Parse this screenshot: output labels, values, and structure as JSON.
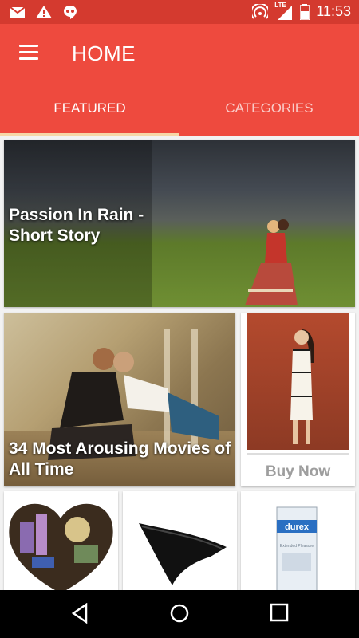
{
  "status_bar": {
    "icons": [
      "gmail-icon",
      "warning-icon",
      "hangouts-icon",
      "hotspot-icon",
      "lte-signal-icon",
      "battery-icon"
    ],
    "network": "LTE",
    "time": "11:53"
  },
  "app_bar": {
    "title": "HOME",
    "menu_icon": "menu-icon"
  },
  "tabs": [
    {
      "label": "FEATURED",
      "active": true
    },
    {
      "label": "CATEGORIES",
      "active": false
    }
  ],
  "featured": {
    "cards": [
      {
        "title": "Passion In Rain - Short Story"
      },
      {
        "title": "34 Most Arousing Movies of All Time"
      }
    ],
    "shop": {
      "button_label": "Buy Now"
    },
    "products": [
      {
        "name": "heart-gift-basket"
      },
      {
        "name": "black-lace-lingerie"
      },
      {
        "name": "condom-box",
        "brand": "durex",
        "subtitle": "Extended Pleasure"
      }
    ]
  },
  "colors": {
    "status_bar": "#d43a2f",
    "app_bar": "#ee4a3e",
    "tab_indicator": "#f6d7a7",
    "navigation_bar": "#000000"
  },
  "nav_bar": [
    "back-icon",
    "home-icon",
    "recents-icon"
  ]
}
